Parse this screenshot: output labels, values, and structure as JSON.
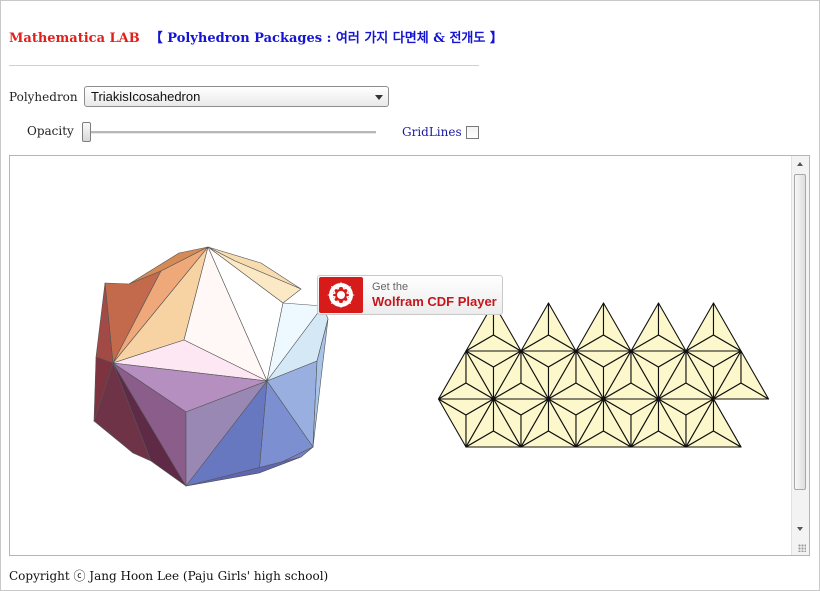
{
  "header": {
    "title_lab": "Mathematica LAB",
    "title_package": "【  Polyhedron Packages : 여러 가지 다면체 & 전개도  】"
  },
  "controls": {
    "polyhedron_label": "Polyhedron",
    "polyhedron_value": "TriakisIcosahedron",
    "opacity_label": "Opacity",
    "opacity_value": 0,
    "gridlines_label": "GridLines",
    "gridlines_checked": false
  },
  "overlay": {
    "line1": "Get the",
    "line2": "Wolfram CDF Player"
  },
  "footer": {
    "copyright": "Copyright ⓒ Jang Hoon Lee (Paju Girls' high school)"
  },
  "colors": {
    "title_red": "#e0201a",
    "title_blue": "#1414d2",
    "net_fill": "#fcf8cc",
    "cdf_red": "#d71a1a"
  }
}
